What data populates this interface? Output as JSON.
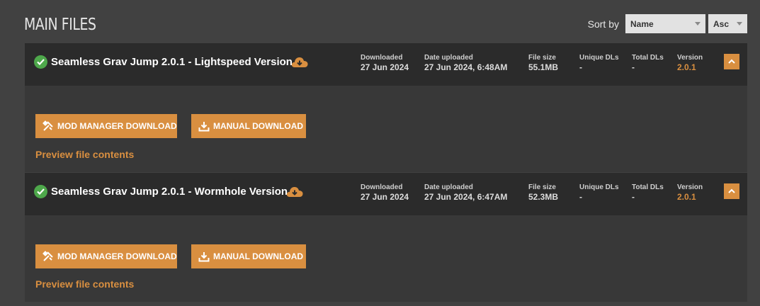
{
  "section_title": "MAIN FILES",
  "sort": {
    "label": "Sort by",
    "field": "Name",
    "direction": "Asc"
  },
  "stat_labels": {
    "downloaded": "Downloaded",
    "date_uploaded": "Date uploaded",
    "file_size": "File size",
    "unique_dls": "Unique DLs",
    "total_dls": "Total DLs",
    "version": "Version"
  },
  "files": [
    {
      "title": "Seamless Grav Jump 2.0.1 - Lightspeed Version",
      "downloaded": "27 Jun 2024",
      "date_uploaded": "27 Jun 2024, 6:48AM",
      "file_size": "55.1MB",
      "unique_dls": "-",
      "total_dls": "-",
      "version": "2.0.1",
      "mod_manager_label": "MOD MANAGER DOWNLOAD",
      "manual_label": "MANUAL DOWNLOAD",
      "preview_label": "Preview file contents"
    },
    {
      "title": "Seamless Grav Jump 2.0.1 - Wormhole Version",
      "downloaded": "27 Jun 2024",
      "date_uploaded": "27 Jun 2024, 6:47AM",
      "file_size": "52.3MB",
      "unique_dls": "-",
      "total_dls": "-",
      "version": "2.0.1",
      "mod_manager_label": "MOD MANAGER DOWNLOAD",
      "manual_label": "MANUAL DOWNLOAD",
      "preview_label": "Preview file contents"
    }
  ],
  "icons": {
    "status": "check-icon",
    "cloud": "cloud-download-icon",
    "collapse": "chevron-up-icon",
    "mod_manager": "wrench-screwdriver-icon",
    "manual": "download-tray-icon"
  },
  "colors": {
    "accent": "#d98f40",
    "success": "#4ea84b",
    "background": "#414141",
    "header": "#2b2b2b",
    "body": "#383838"
  }
}
